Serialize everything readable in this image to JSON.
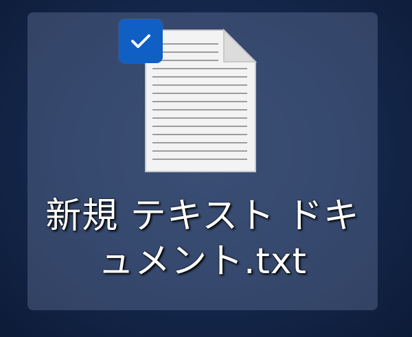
{
  "desktop_icon": {
    "filename": "新規 テキスト ドキュメント.txt",
    "file_type": "text-document",
    "selected": true,
    "icon_name": "text-file-icon"
  },
  "colors": {
    "desktop_background": "#14274b",
    "checkbox_accent": "#0f5fc5",
    "label_text": "#ffffff"
  }
}
